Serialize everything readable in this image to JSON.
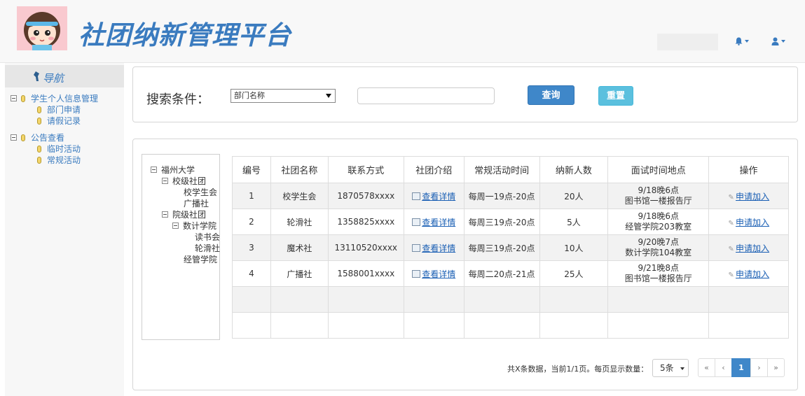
{
  "header": {
    "app_title": "社团纳新管理平台",
    "bell_icon": "bell-icon",
    "user_icon": "user-icon"
  },
  "sidebar": {
    "nav_title": "导航",
    "groups": [
      {
        "label": "学生个人信息管理",
        "items": [
          "部门申请",
          "请假记录"
        ]
      },
      {
        "label": "公告查看",
        "items": [
          "临时活动",
          "常规活动"
        ]
      }
    ]
  },
  "search": {
    "label": "搜索条件：",
    "select_value": "部门名称",
    "input_value": "",
    "query_button": "查询",
    "reset_button": "重置"
  },
  "org_tree": {
    "root": "福州大学",
    "school_level": "校级社团",
    "school_children": [
      "校学生会",
      "广播社"
    ],
    "college_level": "院级社团",
    "college_sub": "数计学院",
    "college_sub_children": [
      "读书会",
      "轮滑社"
    ],
    "college_other": "经管学院"
  },
  "table": {
    "columns": [
      "编号",
      "社团名称",
      "联系方式",
      "社团介绍",
      "常规活动时间",
      "纳新人数",
      "面试时间地点",
      "操作"
    ],
    "detail_link": "查看详情",
    "apply_link": "申请加入",
    "rows": [
      {
        "id": "1",
        "name": "校学生会",
        "contact": "1870578xxxx",
        "time": "每周一19点-20点",
        "count": "20人",
        "interview_1": "9/18晚6点",
        "interview_2": "图书馆一楼报告厅"
      },
      {
        "id": "2",
        "name": "轮滑社",
        "contact": "1358825xxxx",
        "time": "每周三19点-20点",
        "count": "5人",
        "interview_1": "9/18晚6点",
        "interview_2": "经管学院203教室"
      },
      {
        "id": "3",
        "name": "魔术社",
        "contact": "13110520xxxx",
        "time": "每周三19点-20点",
        "count": "10人",
        "interview_1": "9/20晚7点",
        "interview_2": "数计学院104教室"
      },
      {
        "id": "4",
        "name": "广播社",
        "contact": "1588001xxxx",
        "time": "每周二20点-21点",
        "count": "25人",
        "interview_1": "9/21晚8点",
        "interview_2": "图书馆一楼报告厅"
      }
    ]
  },
  "pagination": {
    "info": "共X条数据，当前1/1页。每页显示数量：",
    "page_size": "5条",
    "first": "«",
    "prev": "‹",
    "current": "1",
    "next": "›",
    "last": "»"
  }
}
